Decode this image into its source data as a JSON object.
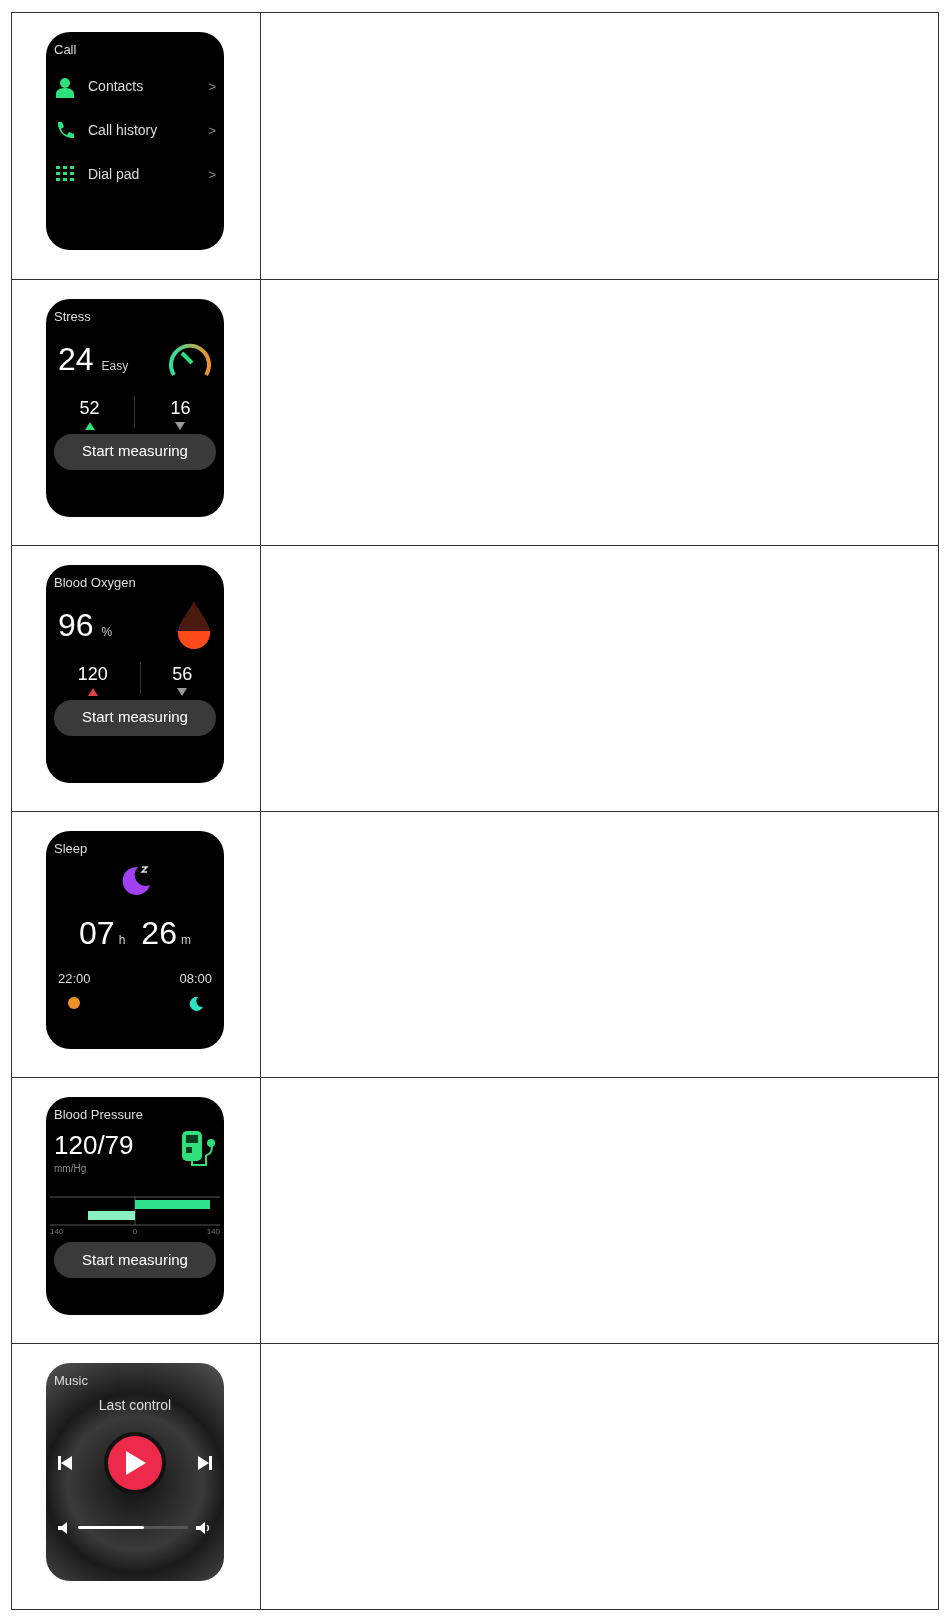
{
  "rows": [
    {
      "kind": "call",
      "title": "Call",
      "items": [
        {
          "kind": "contacts",
          "label": "Contacts",
          "chevron": ">"
        },
        {
          "kind": "history",
          "label": "Call history",
          "chevron": ">"
        },
        {
          "kind": "dialpad",
          "label": "Dial pad",
          "chevron": ">"
        }
      ]
    },
    {
      "kind": "stress",
      "title": "Stress",
      "value": "24",
      "unit": "Easy",
      "high": "52",
      "low": "16",
      "button": "Start measuring"
    },
    {
      "kind": "oxygen",
      "title": "Blood Oxygen",
      "value": "96",
      "unit": "%",
      "high": "120",
      "low": "56",
      "button": "Start measuring"
    },
    {
      "kind": "sleep",
      "title": "Sleep",
      "hours": "07",
      "hours_unit": "h",
      "minutes": "26",
      "minutes_unit": "m",
      "start": "22:00",
      "end": "08:00"
    },
    {
      "kind": "pressure",
      "title": "Blood Pressure",
      "value": "120/79",
      "unit": "mm/Hg",
      "ticks": [
        "140",
        "0",
        "140"
      ],
      "button": "Start measuring"
    },
    {
      "kind": "music",
      "title": "Music",
      "subtitle": "Last control",
      "volume": {
        "level": 0.6
      }
    }
  ]
}
